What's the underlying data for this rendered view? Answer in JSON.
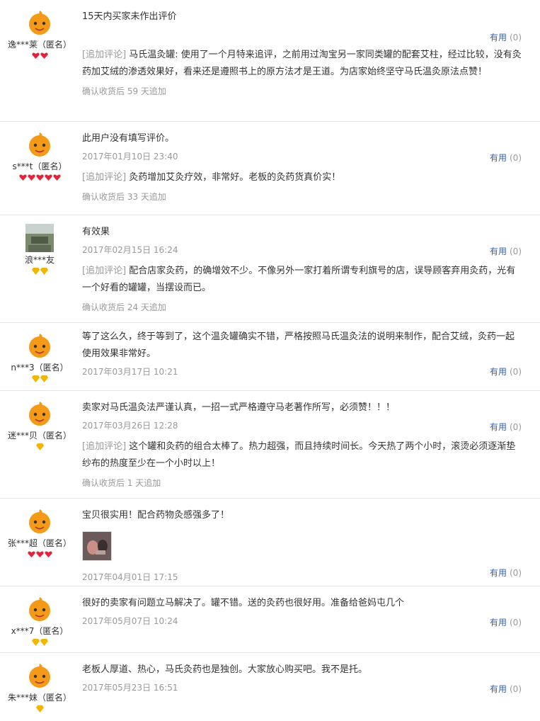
{
  "useful_label": "有用",
  "useful_count": "(0)",
  "append_tag": "[追加评论]",
  "reviews": [
    {
      "user": "逸***莱（匿名）",
      "text": "15天内买家未作出评价",
      "date": "",
      "append": "马氏温灸罐: 使用了一个月特来追评，之前用过淘宝另一家同类罐的配套艾柱，经过比较，没有灸药加艾绒的渗透效果好，看来还是遵照书上的原方法才是王道。为店家始终坚守马氏温灸原法点赞！",
      "append_date": "确认收货后 59 天追加"
    },
    {
      "user": "s***t（匿名）",
      "text": "此用户没有填写评价。",
      "date": "2017年01月10日 23:40",
      "append": "灸药增加艾灸疗效，非常好。老板的灸药货真价实！",
      "append_date": "确认收货后 33 天追加"
    },
    {
      "user": "浪***友",
      "text": "有效果",
      "date": "2017年02月15日 16:24",
      "append": "配合店家灸药，的确增效不少。不像另外一家打着所谓专利旗号的店，误导顾客弃用灸药，光有一个好看的罐罐，当摆设而已。",
      "append_date": "确认收货后 24 天追加"
    },
    {
      "user": "n***3（匿名）",
      "text": "等了这么久，终于等到了，这个温灸罐确实不错，严格按照马氏温灸法的说明来制作，配合艾绒，灸药一起使用效果非常好。",
      "date": "2017年03月17日 10:21"
    },
    {
      "user": "迷***贝（匿名）",
      "text": "卖家对马氏温灸法严谨认真，一招一式严格遵守马老著作所写，必须赞！！！",
      "date": "2017年03月26日 12:28",
      "append": "这个罐和灸药的组合太棒了。热力超强，而且持续时间长。今天热了两个小时，滚烫必须逐渐垫纱布的热度至少在一个小时以上！",
      "append_date": "确认收货后 1 天追加"
    },
    {
      "user": "张***超（匿名）",
      "text": "宝贝很实用！配合药物灸感强多了！",
      "date": "2017年04月01日 17:15"
    },
    {
      "user": "x***7（匿名）",
      "text": "很好的卖家有问题立马解决了。罐不错。送的灸药也很好用。准备给爸妈屯几个",
      "date": "2017年05月07日 10:24"
    },
    {
      "user": "朱***妹（匿名）",
      "text": "老板人厚道、热心，马氏灸药也是独创。大家放心购买吧。我不是托。",
      "date": "2017年05月23日 16:51"
    }
  ]
}
